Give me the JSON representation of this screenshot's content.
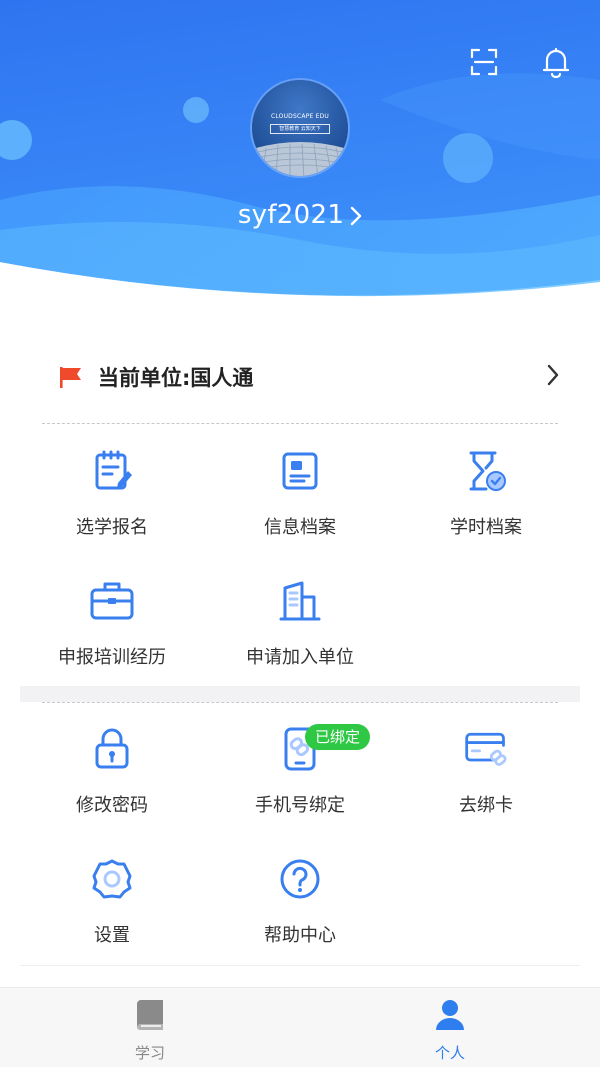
{
  "header": {
    "username": "syf2021",
    "avatar_brand": "CLOUDSCAPE EDU",
    "avatar_slogan": "智慧教育 云知天下"
  },
  "org": {
    "label": "当前单位:国人通"
  },
  "section1": {
    "items": [
      {
        "label": "选学报名",
        "icon": "clipboard-edit-icon"
      },
      {
        "label": "信息档案",
        "icon": "profile-card-icon"
      },
      {
        "label": "学时档案",
        "icon": "hourglass-check-icon"
      },
      {
        "label": "申报培训经历",
        "icon": "briefcase-icon"
      },
      {
        "label": "申请加入单位",
        "icon": "building-icon"
      }
    ]
  },
  "section2": {
    "items": [
      {
        "label": "修改密码",
        "icon": "lock-icon"
      },
      {
        "label": "手机号绑定",
        "icon": "phone-link-icon",
        "badge": "已绑定"
      },
      {
        "label": "去绑卡",
        "icon": "card-link-icon"
      },
      {
        "label": "设置",
        "icon": "gear-icon"
      },
      {
        "label": "帮助中心",
        "icon": "help-circle-icon"
      }
    ]
  },
  "tabbar": {
    "tabs": [
      {
        "label": "学习",
        "icon": "book-icon",
        "active": false
      },
      {
        "label": "个人",
        "icon": "person-icon",
        "active": true
      }
    ]
  },
  "colors": {
    "accent": "#2f7ef0",
    "header_top": "#2f78f2",
    "header_light": "#5fb2ff",
    "badge_green": "#2fc845",
    "flag_red": "#f04a2d"
  }
}
